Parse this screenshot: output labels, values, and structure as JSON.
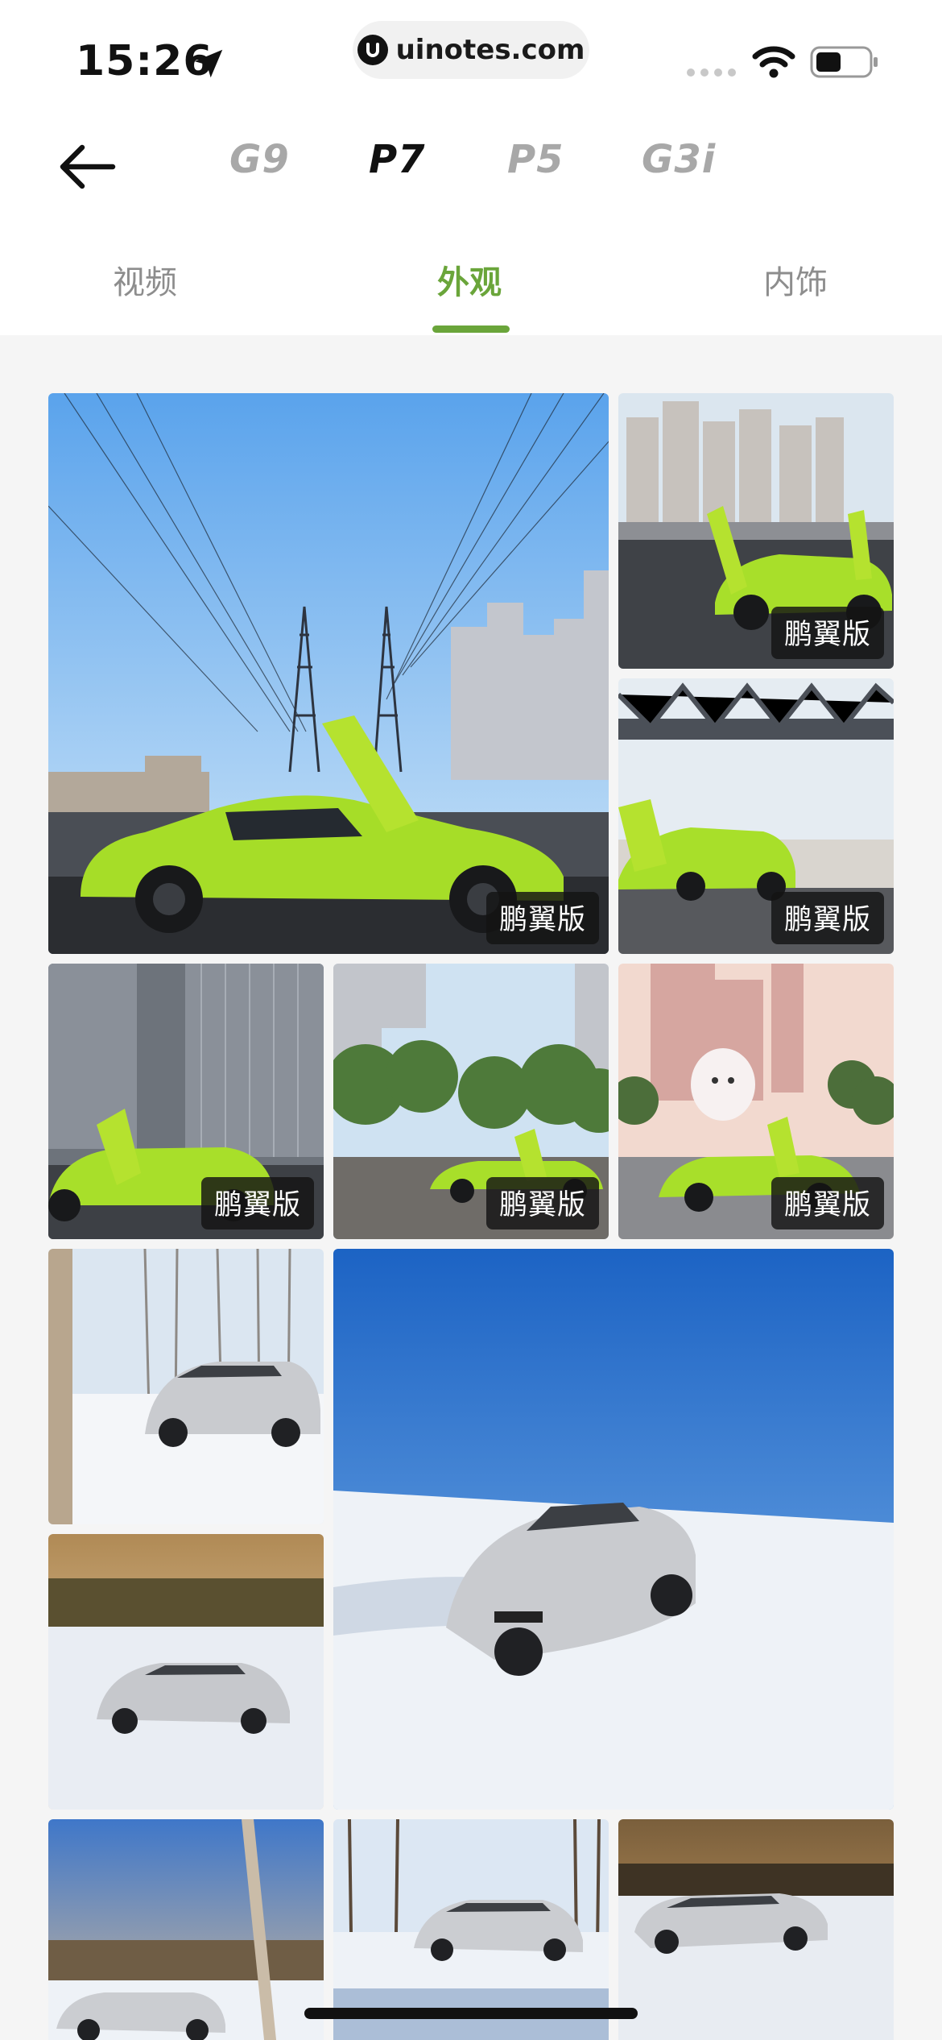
{
  "status_bar": {
    "time": "15:26",
    "url": "uinotes.com",
    "icons": [
      "location-arrow-icon",
      "signal-dots-icon",
      "wifi-icon",
      "battery-icon"
    ]
  },
  "model_nav": {
    "back_icon": "arrow-left-icon",
    "models": [
      {
        "label": "G9",
        "active": false
      },
      {
        "label": "P7",
        "active": true
      },
      {
        "label": "P5",
        "active": false
      },
      {
        "label": "G3i",
        "active": false
      }
    ]
  },
  "view_tabs": {
    "items": [
      {
        "label": "视频",
        "active": false
      },
      {
        "label": "外观",
        "active": true
      },
      {
        "label": "内饰",
        "active": false
      }
    ],
    "accent_color": "#6aa53a"
  },
  "gallery": {
    "badge_text": "鹏翼版",
    "photos": [
      {
        "scene": "lime car, power pylons, wing doors open",
        "badge": "鹏翼版"
      },
      {
        "scene": "lime car on bridge road, doors up",
        "badge": "鹏翼版"
      },
      {
        "scene": "lime car under steel truss bridge",
        "badge": "鹏翼版"
      },
      {
        "scene": "lime car in front of glass building",
        "badge": "鹏翼版"
      },
      {
        "scene": "lime car on tree-lined road",
        "badge": "鹏翼版"
      },
      {
        "scene": "lime car with mascot statue",
        "badge": "鹏翼版"
      },
      {
        "scene": "silver car in snowy birch forest",
        "badge": ""
      },
      {
        "scene": "silver car on snow at sunset",
        "badge": ""
      },
      {
        "scene": "silver car drifting on snow, blue sky",
        "badge": ""
      },
      {
        "scene": "silver car by snowy tree at sunrise",
        "badge": ""
      },
      {
        "scene": "silver car among bare trees",
        "badge": ""
      },
      {
        "scene": "silver car drifting at dusk",
        "badge": ""
      }
    ]
  }
}
